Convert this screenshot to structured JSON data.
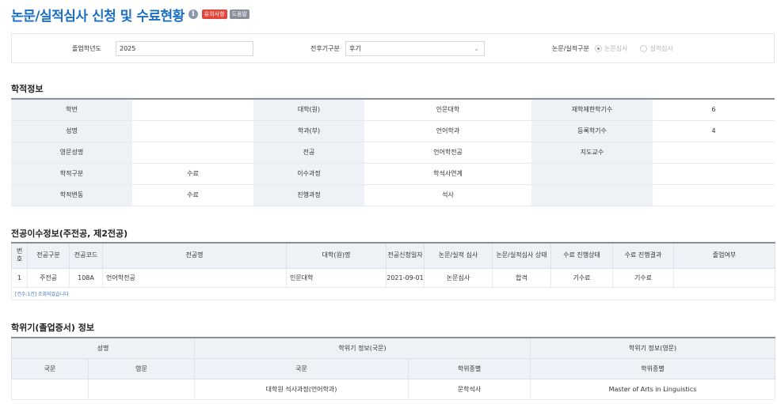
{
  "header": {
    "title": "논문/실적심사 신청 및 수료현황",
    "info_icon": "i",
    "badge_notice": "유의사항",
    "badge_help": "도움말"
  },
  "search": {
    "grad_year_label": "졸업학년도",
    "grad_year_value": "2025",
    "term_label": "전후기구분",
    "term_value": "후기",
    "review_type_label": "논문/실적구분",
    "options": [
      "논문심사",
      "실적심사"
    ],
    "selected": "논문심사"
  },
  "academic_info": {
    "section_title": "학적정보",
    "rows": [
      [
        "학번",
        "",
        "대학(원)",
        "인문대학",
        "재학제한학기수",
        "6"
      ],
      [
        "성명",
        "",
        "학과(부)",
        "언어학과",
        "등록학기수",
        "4"
      ],
      [
        "영문성명",
        "",
        "전공",
        "언어학전공",
        "지도교수",
        ""
      ],
      [
        "학적구분",
        "수료",
        "이수과정",
        "학석사연계",
        "",
        ""
      ],
      [
        "학적변동",
        "수료",
        "진행과정",
        "석사",
        "",
        ""
      ]
    ]
  },
  "major_info": {
    "section_title": "전공이수정보(주전공, 제2전공)",
    "headers": [
      "번호",
      "전공구분",
      "전공코드",
      "전공명",
      "대학(원)명",
      "전공신청일자",
      "논문/실적 심사",
      "논문/실적심사 상태",
      "수료 진행상태",
      "수료 진행결과",
      "졸업여부"
    ],
    "rows": [
      [
        "1",
        "주전공",
        "108A",
        "언어학전공",
        "인문대학",
        "2021-09-01",
        "논문심사",
        "합격",
        "기수료",
        "기수료",
        ""
      ]
    ],
    "note": "[건수:1건] 조회되었습니다"
  },
  "degree_info": {
    "section_title": "학위기(졸업증서) 정보",
    "group_headers": [
      "성명",
      "학위기 정보(국문)",
      "학위기 정보(영문)"
    ],
    "sub_headers": [
      "국문",
      "영문",
      "국문",
      "학위종별",
      "학위종별"
    ],
    "rows": [
      [
        "",
        "",
        "대학원 석사과정(언어학과)",
        "문학석사",
        "Master of Arts in Linguistics"
      ]
    ]
  }
}
